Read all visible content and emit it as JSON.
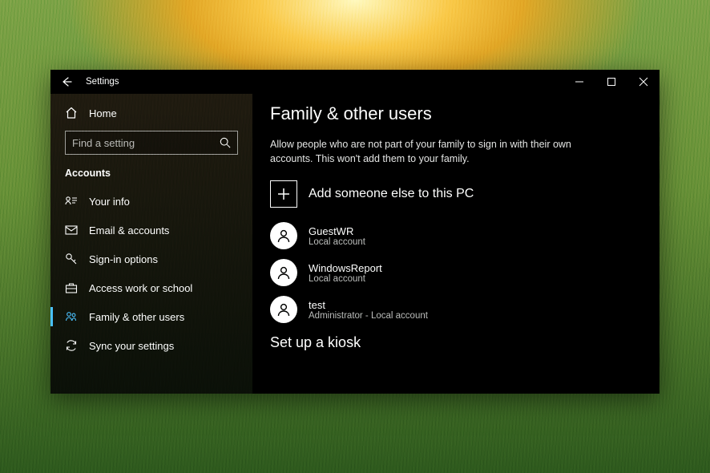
{
  "window": {
    "title": "Settings"
  },
  "sidebar": {
    "home": "Home",
    "search_placeholder": "Find a setting",
    "category": "Accounts",
    "items": [
      {
        "label": "Your info"
      },
      {
        "label": "Email & accounts"
      },
      {
        "label": "Sign-in options"
      },
      {
        "label": "Access work or school"
      },
      {
        "label": "Family & other users"
      },
      {
        "label": "Sync your settings"
      }
    ],
    "selected_index": 4
  },
  "main": {
    "heading": "Family & other users",
    "description": "Allow people who are not part of your family to sign in with their own accounts. This won't add them to your family.",
    "add_label": "Add someone else to this PC",
    "users": [
      {
        "name": "GuestWR",
        "subtitle": "Local account"
      },
      {
        "name": "WindowsReport",
        "subtitle": "Local account"
      },
      {
        "name": "test",
        "subtitle": "Administrator - Local account"
      }
    ],
    "kiosk_heading": "Set up a kiosk"
  }
}
